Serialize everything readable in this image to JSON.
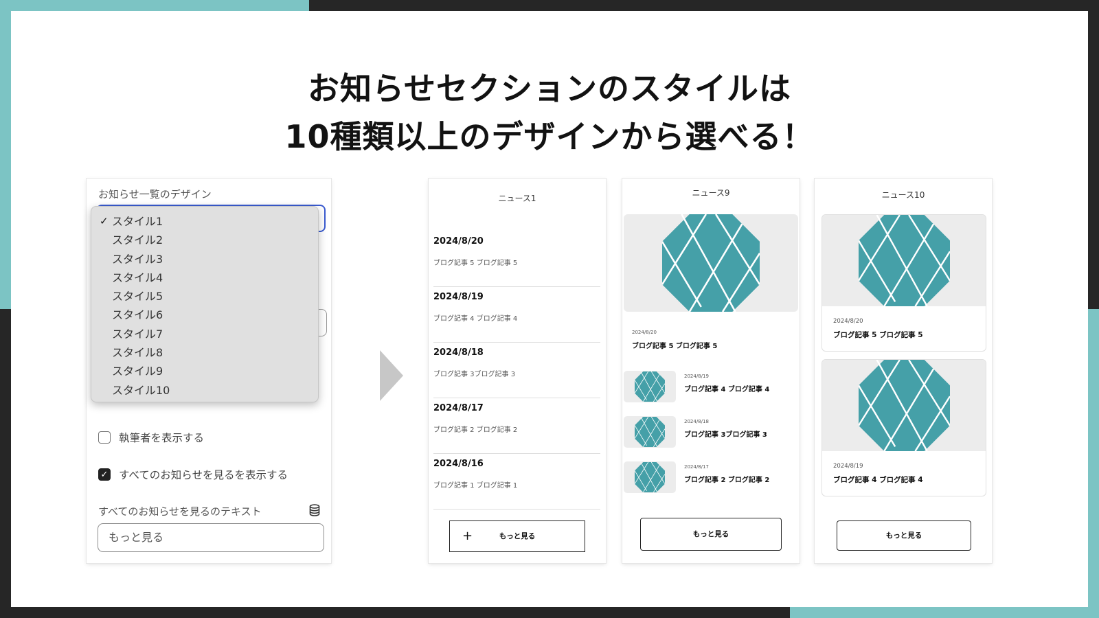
{
  "headline": {
    "line1": "お知らせセクションのスタイルは",
    "line2": "10種類以上のデザインから選べる！"
  },
  "colors": {
    "accent": "#7cc4c4",
    "frame": "#262626",
    "select_border": "#3a5bd0",
    "thumb_teal": "#45a0a8"
  },
  "settings": {
    "design_label": "お知らせ一覧のデザイン",
    "selected": "スタイル1",
    "options": [
      "スタイル1",
      "スタイル2",
      "スタイル3",
      "スタイル4",
      "スタイル5",
      "スタイル6",
      "スタイル7",
      "スタイル8",
      "スタイル9",
      "スタイル10"
    ],
    "checkbox_author": {
      "label": "執筆者を表示する",
      "checked": false
    },
    "checkbox_view_all": {
      "label": "すべてのお知らせを見るを表示する",
      "checked": true
    },
    "view_all_text_label": "すべてのお知らせを見るのテキスト",
    "view_all_text_value": "もっと見る"
  },
  "style1": {
    "title": "ニュース1",
    "items": [
      {
        "date": "2024/8/20",
        "title": "ブログ記事 5 ブログ記事 5"
      },
      {
        "date": "2024/8/19",
        "title": "ブログ記事 4 ブログ記事 4"
      },
      {
        "date": "2024/8/18",
        "title": "ブログ記事 3ブログ記事 3"
      },
      {
        "date": "2024/8/17",
        "title": "ブログ記事 2 ブログ記事 2"
      },
      {
        "date": "2024/8/16",
        "title": "ブログ記事 1 ブログ記事 1"
      }
    ],
    "button_icon": "+",
    "button": "もっと見る"
  },
  "style9": {
    "title": "ニュース9",
    "featured": {
      "date": "2024/8/20",
      "title": "ブログ記事 5 ブログ記事 5"
    },
    "items": [
      {
        "date": "2024/8/19",
        "title": "ブログ記事 4 ブログ記事 4"
      },
      {
        "date": "2024/8/18",
        "title": "ブログ記事 3ブログ記事 3"
      },
      {
        "date": "2024/8/17",
        "title": "ブログ記事 2 ブログ記事 2"
      }
    ],
    "button": "もっと見る"
  },
  "style10": {
    "title": "ニュース10",
    "items": [
      {
        "date": "2024/8/20",
        "title": "ブログ記事 5 ブログ記事 5"
      },
      {
        "date": "2024/8/19",
        "title": "ブログ記事 4 ブログ記事 4"
      }
    ],
    "button": "もっと見る"
  }
}
